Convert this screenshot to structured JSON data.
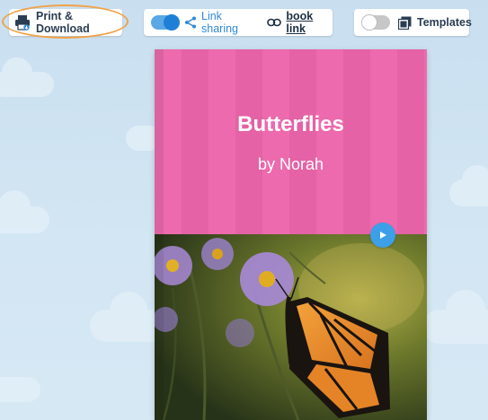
{
  "toolbar": {
    "print_label": "Print & Download",
    "link_sharing_label": "Link sharing",
    "link_sharing_on": true,
    "book_link_label": "book link",
    "templates_label": "Templates",
    "templates_on": false
  },
  "book": {
    "title": "Butterflies",
    "author": "by Norah",
    "cover_color": "#ec6aad"
  },
  "colors": {
    "accent": "#2f8ad6",
    "highlight_ring": "#f1a248",
    "background": "#cfe3f1"
  },
  "icons": [
    "printer-icon",
    "share-icon",
    "link-icon",
    "templates-icon",
    "play-icon"
  ]
}
